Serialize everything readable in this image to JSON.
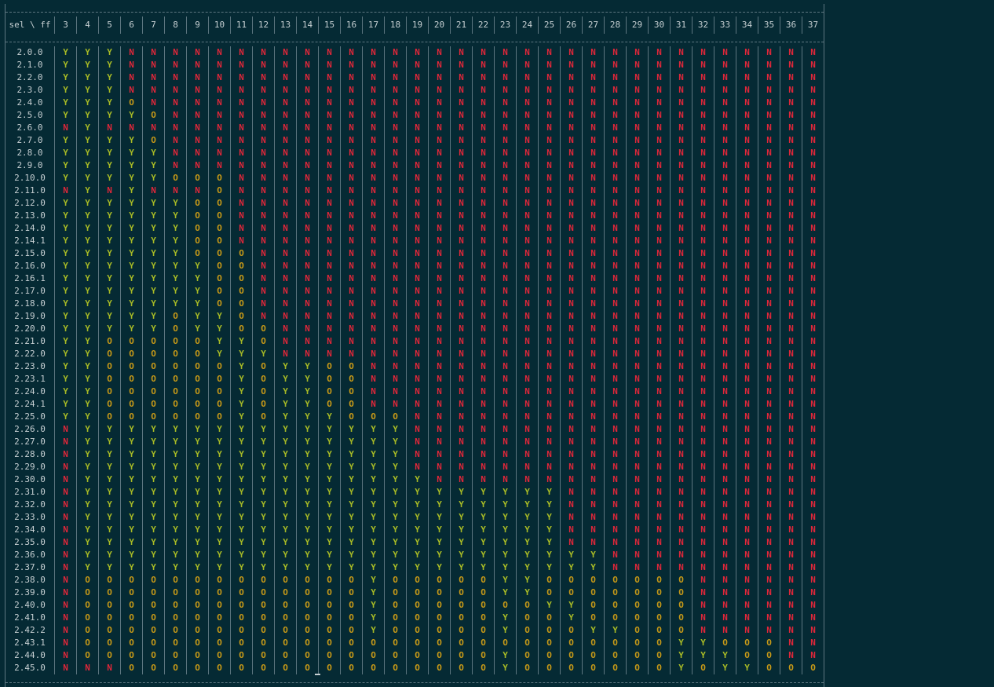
{
  "header": {
    "corner": "sel \\ ff",
    "columns": [
      "3",
      "4",
      "5",
      "6",
      "7",
      "8",
      "9",
      "10",
      "11",
      "12",
      "13",
      "14",
      "15",
      "16",
      "17",
      "18",
      "19",
      "20",
      "21",
      "22",
      "23",
      "24",
      "25",
      "26",
      "27",
      "28",
      "29",
      "30",
      "31",
      "32",
      "33",
      "34",
      "35",
      "36",
      "37"
    ]
  },
  "rows": [
    {
      "label": "2.0.0",
      "cells": "YYYNNNNNNNNNNNNNNNNNNNNNNNNNNNNNNNN"
    },
    {
      "label": "2.1.0",
      "cells": "YYYNNNNNNNNNNNNNNNNNNNNNNNNNNNNNNNN"
    },
    {
      "label": "2.2.0",
      "cells": "YYYNNNNNNNNNNNNNNNNNNNNNNNNNNNNNNNN"
    },
    {
      "label": "2.3.0",
      "cells": "YYYNNNNNNNNNNNNNNNNNNNNNNNNNNNNNNNN"
    },
    {
      "label": "2.4.0",
      "cells": "YYYONNNNNNNNNNNNNNNNNNNNNNNNNNNNNNN"
    },
    {
      "label": "2.5.0",
      "cells": "YYYYONNNNNNNNNNNNNNNNNNNNNNNNNNNNNN"
    },
    {
      "label": "2.6.0",
      "cells": "NYNNNNNNNNNNNNNNNNNNNNNNNNNNNNNNNNN"
    },
    {
      "label": "2.7.0",
      "cells": "YYYYONNNNNNNNNNNNNNNNNNNNNNNNNNNNNN"
    },
    {
      "label": "2.8.0",
      "cells": "YYYYYNNNNNNNNNNNNNNNNNNNNNNNNNNNNNN"
    },
    {
      "label": "2.9.0",
      "cells": "YYYYYNNNNNNNNNNNNNNNNNNNNNNNNNNNNNN"
    },
    {
      "label": "2.10.0",
      "cells": "YYYYYOOONNNNNNNNNNNNNNNNNNNNNNNNNNN"
    },
    {
      "label": "2.11.0",
      "cells": "NYNYNNNONNNNNNNNNNNNNNNNNNNNNNNNNNN"
    },
    {
      "label": "2.12.0",
      "cells": "YYYYYYOONNNNNNNNNNNNNNNNNNNNNNNNNNN"
    },
    {
      "label": "2.13.0",
      "cells": "YYYYYYOONNNNNNNNNNNNNNNNNNNNNNNNNNN"
    },
    {
      "label": "2.14.0",
      "cells": "YYYYYYOONNNNNNNNNNNNNNNNNNNNNNNNNNN"
    },
    {
      "label": "2.14.1",
      "cells": "YYYYYYOONNNNNNNNNNNNNNNNNNNNNNNNNNN"
    },
    {
      "label": "2.15.0",
      "cells": "YYYYYYOOONNNNNNNNNNNNNNNNNNNNNNNNNN"
    },
    {
      "label": "2.16.0",
      "cells": "YYYYYYYOONNNNNNNNNNNNNNNNNNNNNNNNNN"
    },
    {
      "label": "2.16.1",
      "cells": "YYYYYYYOONNNNNNNNNNNNNNNNNNNNNNNNNN"
    },
    {
      "label": "2.17.0",
      "cells": "YYYYYYYOONNNNNNNNNNNNNNNNNNNNNNNNNN"
    },
    {
      "label": "2.18.0",
      "cells": "YYYYYYYOONNNNNNNNNNNNNNNNNNNNNNNNNN"
    },
    {
      "label": "2.19.0",
      "cells": "YYYYYOYYONNNNNNNNNNNNNNNNNNNNNNNNNN"
    },
    {
      "label": "2.20.0",
      "cells": "YYYYYOYYOONNNNNNNNNNNNNNNNNNNNNNNNN"
    },
    {
      "label": "2.21.0",
      "cells": "YYOOOOOYYONNNNNNNNNNNNNNNNNNNNNNNNN"
    },
    {
      "label": "2.22.0",
      "cells": "YYOOOOOYYYNNNNNNNNNNNNNNNNNNNNNNNNN"
    },
    {
      "label": "2.23.0",
      "cells": "YYOOOOOOYOYYOONNNNNNNNNNNNNNNNNNNNN"
    },
    {
      "label": "2.23.1",
      "cells": "YYOOOOOOYOYYOONNNNNNNNNNNNNNNNNNNNN"
    },
    {
      "label": "2.24.0",
      "cells": "YYOOOOOOYOYYOONNNNNNNNNNNNNNNNNNNNN"
    },
    {
      "label": "2.24.1",
      "cells": "YYOOOOOOYOYYOONNNNNNNNNNNNNNNNNNNNN"
    },
    {
      "label": "2.25.0",
      "cells": "YYOOOOOOYOYYYOOONNNNNNNNNNNNNNNNNNN"
    },
    {
      "label": "2.26.0",
      "cells": "NYYYYYYYYYYYYYYYNNNNNNNNNNNNNNNNNNN"
    },
    {
      "label": "2.27.0",
      "cells": "NYYYYYYYYYYYYYYYNNNNNNNNNNNNNNNNNNN"
    },
    {
      "label": "2.28.0",
      "cells": "NYYYYYYYYYYYYYYYNNNNNNNNNNNNNNNNNNN"
    },
    {
      "label": "2.29.0",
      "cells": "NYYYYYYYYYYYYYYYNNNNNNNNNNNNNNNNNNN"
    },
    {
      "label": "2.30.0",
      "cells": "NYYYYYYYYYYYYYYYYNNNNNNNNNNNNNNNNNN"
    },
    {
      "label": "2.31.0",
      "cells": "NYYYYYYYYYYYYYYYYYYYYYYNNNNNNNNNNNN"
    },
    {
      "label": "2.32.0",
      "cells": "NYYYYYYYYYYYYYYYYYYYYYYNNNNNNNNNNNN"
    },
    {
      "label": "2.33.0",
      "cells": "NYYYYYYYYYYYYYYYYYYYYYYNNNNNNNNNNNN"
    },
    {
      "label": "2.34.0",
      "cells": "NYYYYYYYYYYYYYYYYYYYYYYNNNNNNNNNNNN"
    },
    {
      "label": "2.35.0",
      "cells": "NYYYYYYYYYYYYYYYYYYYYYYNNNNNNNNNNNN"
    },
    {
      "label": "2.36.0",
      "cells": "NYYYYYYYYYYYYYYYYYYYYYYYYNNNNNNNNNN"
    },
    {
      "label": "2.37.0",
      "cells": "NYYYYYYYYYYYYYYYYYYYYYYYYNNNNNNNNNN"
    },
    {
      "label": "2.38.0",
      "cells": "NOOOOOOOOOOOOOYOOOOOYYOOOOOOONNNNNN"
    },
    {
      "label": "2.39.0",
      "cells": "NOOOOOOOOOOOOOYOOOOOYYOOOOOOONNNNNN"
    },
    {
      "label": "2.40.0",
      "cells": "NOOOOOOOOOOOOOYOOOOOOOYYOOOOONNNNNN"
    },
    {
      "label": "2.41.0",
      "cells": "NOOOOOOOOOOOOOYOOOOOYOOYOOOOONNNNNN"
    },
    {
      "label": "2.42.2",
      "cells": "NOOOOOOOOOOOOOYOOOOOYOOOYYOOONNNNNN"
    },
    {
      "label": "2.43.1",
      "cells": "NOOOOOOOOOOOOOOOOOOOOOOOOOOOYYOOONN"
    },
    {
      "label": "2.44.0",
      "cells": "NOOOOOOOOOOOOOOOOOOOYOOOOOOOYYYOONN"
    },
    {
      "label": "2.45.0",
      "cells": "NNNOOOOOOOOOOOOOOOOOYOOOOOOOYOYYOOO"
    }
  ],
  "colors": {
    "Y": "#a8bb26",
    "N": "#e0273a",
    "O": "#c89a17",
    "background": "#052a34"
  }
}
